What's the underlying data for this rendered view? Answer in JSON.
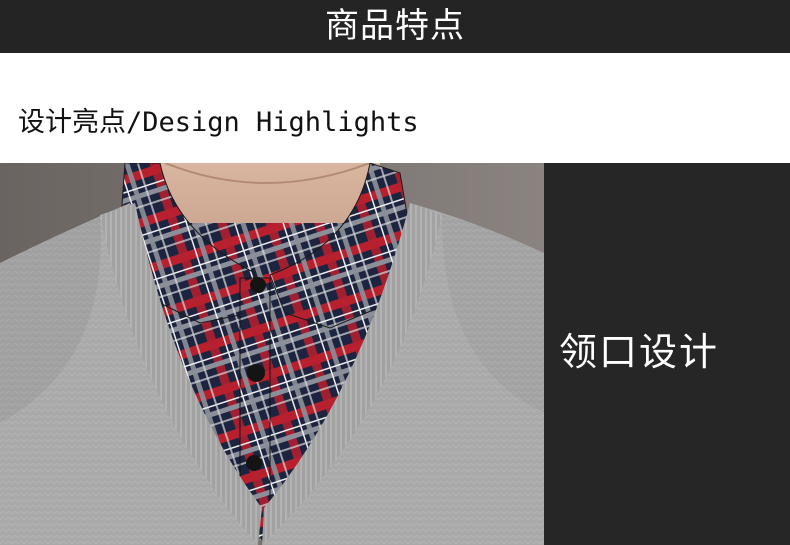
{
  "header": {
    "title": "商品特点"
  },
  "section": {
    "subtitle": "设计亮点/Design Highlights"
  },
  "feature": {
    "label": "领口设计"
  },
  "colors": {
    "header_bg": "#242424",
    "panel_bg": "#262626",
    "sweater_gray": "#a9a9a9",
    "plaid_navy": "#1c2440",
    "plaid_red": "#b8202e"
  }
}
